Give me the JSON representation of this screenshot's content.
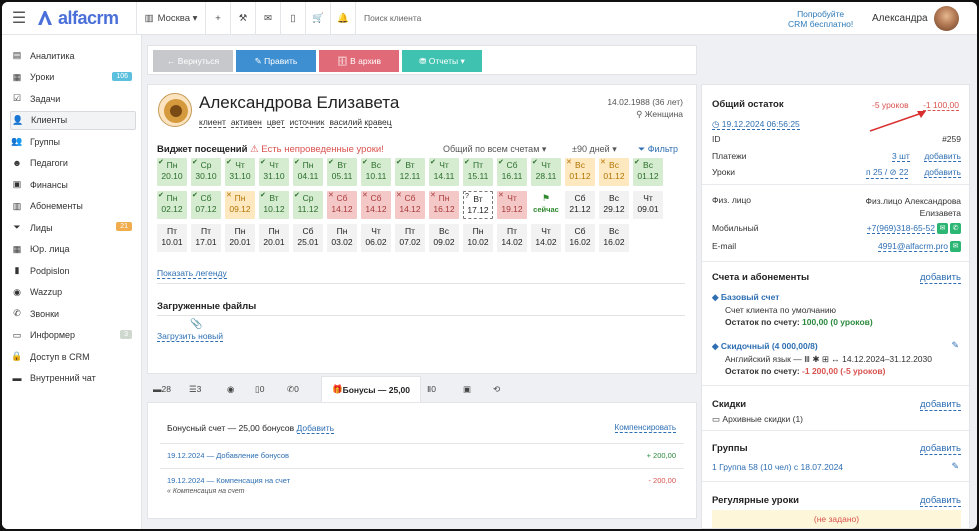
{
  "topbar": {
    "menu_icon": "hamburger-icon",
    "logo": "alfacrm",
    "city": "Москва",
    "search_placeholder": "Поиск клиента",
    "promo_line1": "Попробуйте",
    "promo_line2": "CRM бесплатно!",
    "user": "Александра"
  },
  "sidebar": {
    "items": [
      {
        "label": "Аналитика",
        "icon": "chart-icon"
      },
      {
        "label": "Уроки",
        "icon": "calendar-icon",
        "badge": "106",
        "badge_color": "#5bc0de"
      },
      {
        "label": "Задачи",
        "icon": "tasks-icon"
      },
      {
        "label": "Клиенты",
        "icon": "user-icon",
        "active": true
      },
      {
        "label": "Группы",
        "icon": "group-icon"
      },
      {
        "label": "Педагоги",
        "icon": "teacher-icon"
      },
      {
        "label": "Финансы",
        "icon": "money-icon"
      },
      {
        "label": "Абонементы",
        "icon": "ticket-icon"
      },
      {
        "label": "Лиды",
        "icon": "funnel-icon",
        "badge": "21",
        "badge_color": "#f0ad4e"
      },
      {
        "label": "Юр. лица",
        "icon": "building-icon"
      },
      {
        "label": "Podpislon",
        "icon": "doc-icon"
      },
      {
        "label": "Wazzup",
        "icon": "whatsapp-icon"
      },
      {
        "label": "Звонки",
        "icon": "phone-icon"
      },
      {
        "label": "Информер",
        "icon": "chat-icon",
        "badge": "3",
        "badge_color": "#cfd8cf"
      },
      {
        "label": "Доступ в CRM",
        "icon": "lock-icon"
      },
      {
        "label": "Внутренний чат",
        "icon": "message-icon"
      }
    ]
  },
  "actions": {
    "back": "← Вернуться",
    "edit": "✎ Править",
    "archive": "🗄 В архив",
    "reports": "⛃ Отчеты ▾"
  },
  "client": {
    "name": "Александрова Елизавета",
    "tags": [
      "клиент",
      "активен",
      "цвет",
      "источник",
      "василий кравец"
    ],
    "dob": "14.02.1988 (36 лет)",
    "gender": "Женщина"
  },
  "widget": {
    "title": "Виджет посещений",
    "warning": "⚠ Есть непроведенные уроки!",
    "filter_all": "Общий по всем счетам",
    "filter_days": "±90 дней",
    "filter_label": "Фильтр",
    "rows": [
      [
        [
          "Пн",
          "20.10",
          "g"
        ],
        [
          "Ср",
          "30.10",
          "g"
        ],
        [
          "Чт",
          "31.10",
          "g"
        ],
        [
          "Чт",
          "31.10",
          "g"
        ],
        [
          "Пн",
          "04.11",
          "g"
        ],
        [
          "Вт",
          "05.11",
          "g"
        ],
        [
          "Вс",
          "10.11",
          "g"
        ],
        [
          "Вт",
          "12.11",
          "g"
        ],
        [
          "Чт",
          "14.11",
          "g"
        ],
        [
          "Пт",
          "15.11",
          "g"
        ],
        [
          "Сб",
          "16.11",
          "g"
        ],
        [
          "Чт",
          "28.11",
          "g"
        ],
        [
          "Вс",
          "01.12",
          "y"
        ],
        [
          "Вс",
          "01.12",
          "y"
        ],
        [
          "Вс",
          "01.12",
          "g"
        ]
      ],
      [
        [
          "Пн",
          "02.12",
          "g"
        ],
        [
          "Сб",
          "07.12",
          "g"
        ],
        [
          "Пн",
          "09.12",
          "y"
        ],
        [
          "Вт",
          "10.12",
          "g"
        ],
        [
          "Ср",
          "11.12",
          "g"
        ],
        [
          "Сб",
          "14.12",
          "r"
        ],
        [
          "Сб",
          "14.12",
          "r"
        ],
        [
          "Сб",
          "14.12",
          "r"
        ],
        [
          "Пн",
          "16.12",
          "r"
        ],
        [
          "Вт",
          "17.12",
          "d"
        ],
        [
          "Чт",
          "19.12",
          "r"
        ],
        [
          "сейчас",
          "",
          "n"
        ],
        [
          "Сб",
          "21.12",
          "w"
        ],
        [
          "Вс",
          "29.12",
          "w"
        ],
        [
          "Чт",
          "09.01",
          "w"
        ]
      ],
      [
        [
          "Пт",
          "10.01",
          "w"
        ],
        [
          "Пт",
          "17.01",
          "w"
        ],
        [
          "Пн",
          "20.01",
          "w"
        ],
        [
          "Пн",
          "20.01",
          "w"
        ],
        [
          "Сб",
          "25.01",
          "w"
        ],
        [
          "Пн",
          "03.02",
          "w"
        ],
        [
          "Чт",
          "06.02",
          "w"
        ],
        [
          "Пт",
          "07.02",
          "w"
        ],
        [
          "Вс",
          "09.02",
          "w"
        ],
        [
          "Пн",
          "10.02",
          "w"
        ],
        [
          "Пт",
          "14.02",
          "w"
        ],
        [
          "Чт",
          "14.02",
          "w"
        ],
        [
          "Сб",
          "16.02",
          "w"
        ],
        [
          "Вс",
          "16.02",
          "w"
        ]
      ]
    ],
    "legend": "Показать легенду"
  },
  "files": {
    "title": "Загруженные файлы",
    "upload": "Загрузить новый"
  },
  "tabs": [
    "28",
    "3",
    "",
    "0",
    "0",
    "Бонусы — 25,00",
    "0",
    "",
    ""
  ],
  "bonus": {
    "header": "Бонусный счет — 25,00 бонусов",
    "add": "Добавить",
    "compensate": "Компенсировать",
    "entries": [
      {
        "text": "19.12.2024 — Добавление бонусов",
        "amount": "+ 200,00",
        "sub": ""
      },
      {
        "text": "19.12.2024 — Компенсация на счет",
        "amount": "- 200,00",
        "sub": "« Компенсация на счет"
      }
    ]
  },
  "balance": {
    "title": "Общий остаток",
    "lessons": "-5 уроков",
    "amount": "-1 100,00",
    "date": "19.12.2024 06:56:25",
    "id_label": "ID",
    "id": "#259",
    "payments_label": "Платежи",
    "payments": "3 шт",
    "payments_add": "добавить",
    "lessons_label": "Уроки",
    "lessons_val": "п 25 / ⊘ 22",
    "lessons_add": "добавить"
  },
  "contacts": {
    "person_label": "Физ. лицо",
    "person": "Физ.лицо Александрова Елизавета",
    "mobile_label": "Мобильный",
    "mobile": "+7(969)318-65-52",
    "email_label": "E-mail",
    "email": "4991@alfacrm.pro"
  },
  "accounts": {
    "title": "Счета и абонементы",
    "add": "добавить",
    "base_name": "Базовый счет",
    "base_desc": "Счет клиента по умолчанию",
    "base_bal_label": "Остаток по счету:",
    "base_bal": "100,00 (0 уроков)",
    "disc_name": "Скидочный (4 000,00/8)",
    "disc_desc": "Английский язык — Ⅲ ✱ ⊞ ↔ 14.12.2024–31.12.2030",
    "disc_bal_label": "Остаток по счету:",
    "disc_bal": "-1 200,00 (-5 уроков)"
  },
  "discounts": {
    "title": "Скидки",
    "add": "добавить",
    "archive": "Архивные скидки (1)"
  },
  "groups": {
    "title": "Группы",
    "add": "добавить",
    "item": "1 Группа 58 (10 чел) с 18.07.2024"
  },
  "regular": {
    "title": "Регулярные уроки",
    "add": "добавить",
    "none": "(не задано)"
  }
}
